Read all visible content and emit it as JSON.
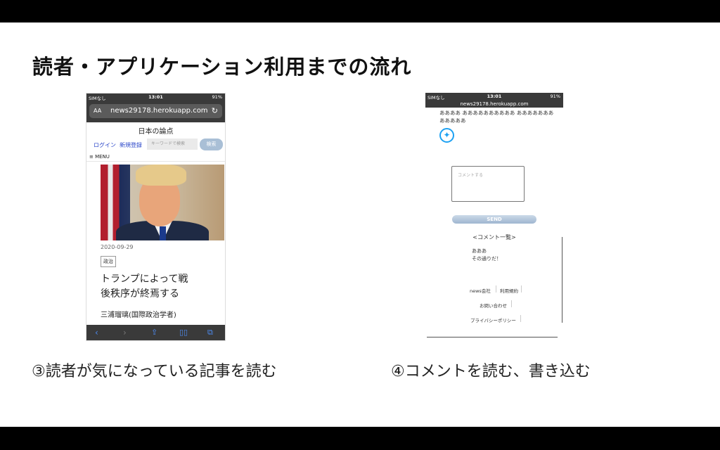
{
  "slide": {
    "title": "読者・アプリケーション利用までの流れ",
    "caption_left": "③読者が気になっている記事を読む",
    "caption_right": "④コメントを読む、書き込む"
  },
  "phone_left": {
    "status": {
      "carrier": "SIMなし",
      "time": "13:01",
      "battery": "91%"
    },
    "url_bar": {
      "aa": "AA",
      "url": "news29178.herokuapp.com"
    },
    "site_title": "日本の論点",
    "login_link": "ログイン",
    "register_link": "新規登録",
    "search_placeholder": "キーワードで検索",
    "search_button": "検索",
    "menu_label": "≡ MENU",
    "article": {
      "date": "2020-09-29",
      "category": "政治",
      "headline_line1": "トランプによって戦",
      "headline_line2": "後秩序が終焉する",
      "author": "三浦瑠璃(国際政治学者)"
    },
    "bottom_icons": [
      "back-icon",
      "forward-icon",
      "share-icon",
      "bookmarks-icon",
      "tabs-icon"
    ]
  },
  "phone_right": {
    "status": {
      "carrier": "SIMなし",
      "time": "13:01",
      "battery": "91%"
    },
    "url": "news29178.herokuapp.com",
    "article_text": "ああああ ああああああああああ ああああああああああああ",
    "comment_placeholder": "コメントする",
    "send_button": "SEND",
    "comment_list_title": "<コメント一覧>",
    "comments": [
      "あああ",
      "その通りだ！"
    ],
    "footer": {
      "company": "news会社",
      "terms": "利用規約",
      "contact": "お問い合わせ",
      "privacy": "プライバシーポリシー"
    }
  }
}
